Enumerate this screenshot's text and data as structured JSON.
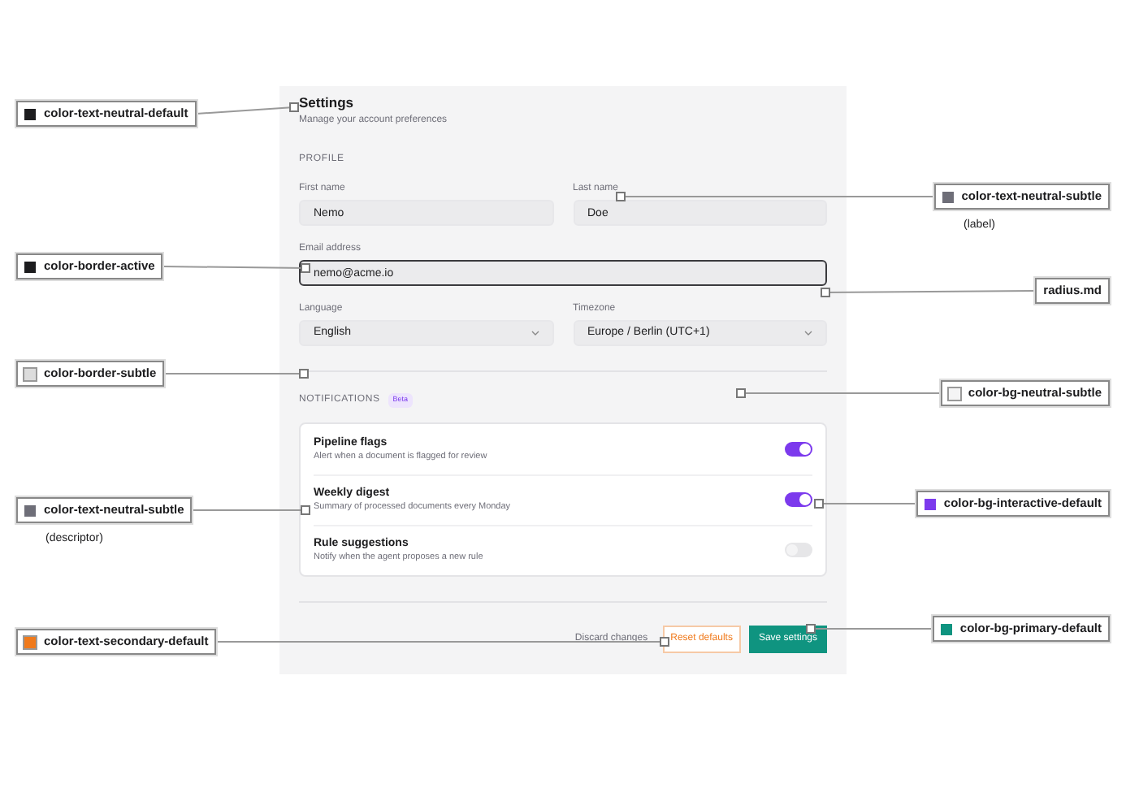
{
  "panel": {
    "title": "Settings",
    "subtitle": "Manage your account preferences",
    "profile": {
      "heading": "PROFILE",
      "fields": [
        {
          "kind": "input",
          "label": "First name",
          "value": "Nemo",
          "focused": false
        },
        {
          "kind": "input",
          "label": "Last name",
          "value": "Doe",
          "focused": false
        },
        {
          "kind": "input",
          "label": "Email address",
          "value": "nemo@acme.io",
          "focused": true
        },
        {
          "kind": "select",
          "label": "Language",
          "value": "English",
          "focused": false
        },
        {
          "kind": "select",
          "label": "Timezone",
          "value": "Europe / Berlin (UTC+1)",
          "focused": false
        }
      ]
    },
    "notifications": {
      "heading": "NOTIFICATIONS",
      "badge": "Beta",
      "items": [
        {
          "title": "Pipeline flags",
          "description": "Alert when a document is flagged for review",
          "on": true
        },
        {
          "title": "Weekly digest",
          "description": "Summary of processed documents every Monday",
          "on": true
        },
        {
          "title": "Rule suggestions",
          "description": "Notify when the agent proposes a new rule",
          "on": false
        }
      ]
    },
    "buttons": [
      {
        "kind": "link",
        "label": "Discard changes"
      },
      {
        "kind": "outline",
        "label": "Reset defaults"
      },
      {
        "kind": "primary",
        "label": "Save settings"
      }
    ]
  },
  "annotations": [
    {
      "label": "color-text-neutral-default",
      "color": "#1c1c1e"
    },
    {
      "label": "color-text-neutral-subtle",
      "color": "#6e6e78",
      "note": "(label)"
    },
    {
      "label": "color-border-active",
      "color": "#1c1c1e"
    },
    {
      "label": "radius.md"
    },
    {
      "label": "color-border-subtle",
      "color": "#dcdcdc"
    },
    {
      "label": "color-bg-neutral-subtle",
      "color": "#f4f4f5"
    },
    {
      "label": "color-text-neutral-subtle",
      "color": "#6e6e78",
      "note": "(descriptor)"
    },
    {
      "label": "color-bg-interactive-default",
      "color": "#7c3aed"
    },
    {
      "label": "color-text-secondary-default",
      "color": "#f07a1c"
    },
    {
      "label": "color-bg-primary-default",
      "color": "#0f9480"
    }
  ]
}
